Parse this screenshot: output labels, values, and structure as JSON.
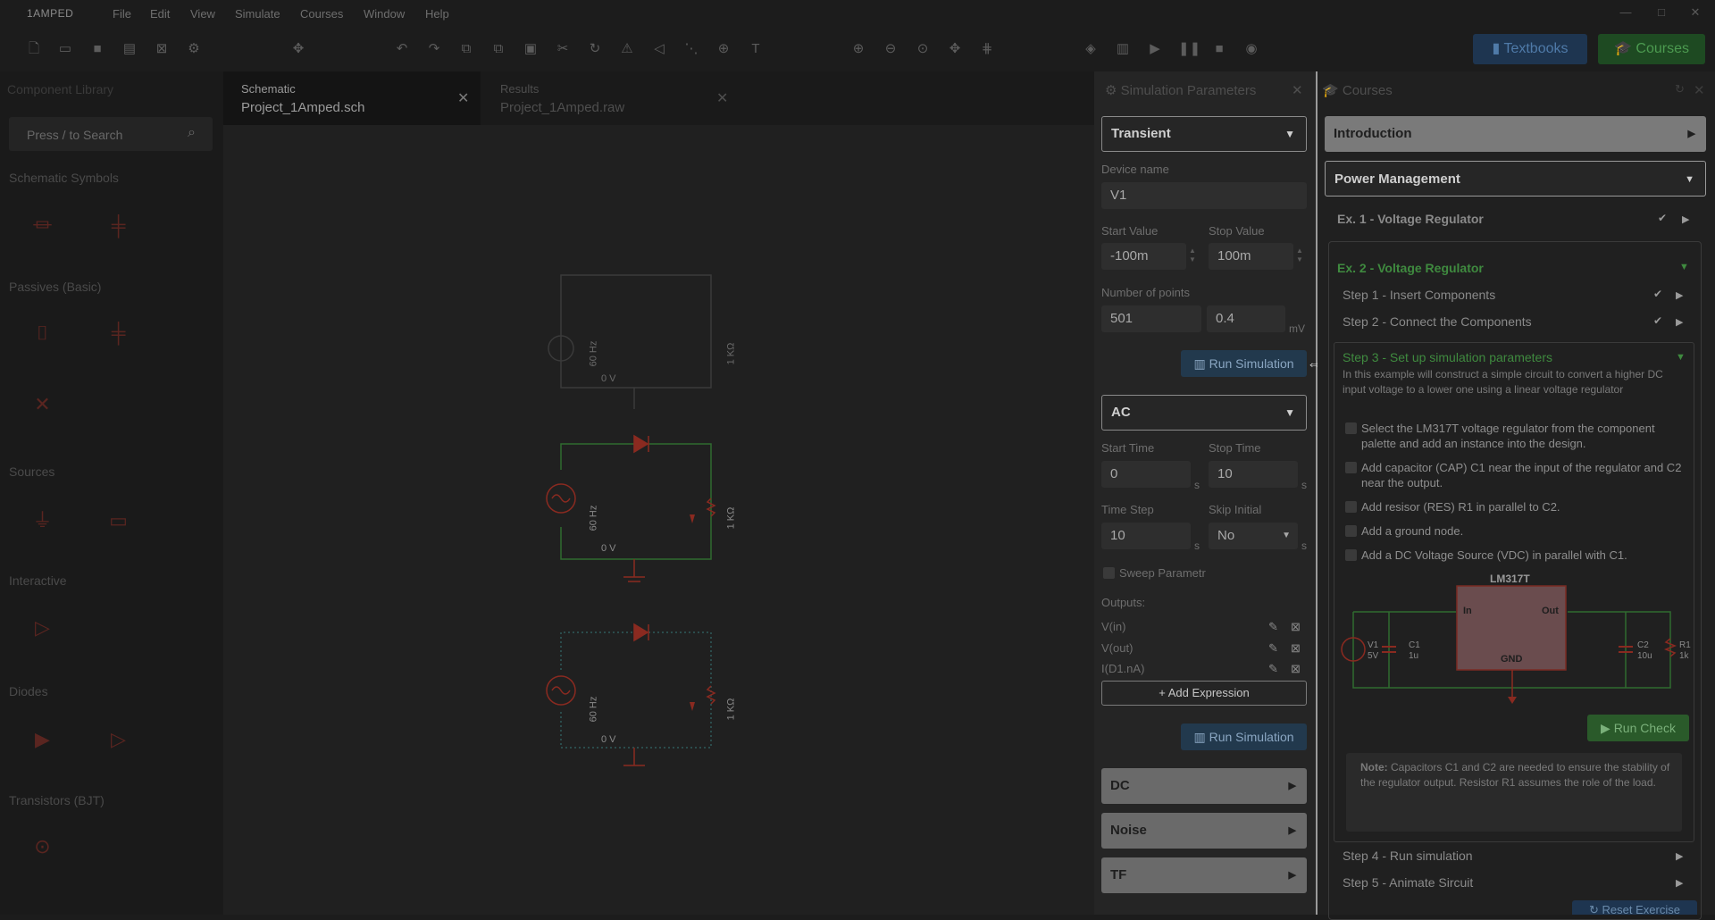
{
  "app": {
    "name": "1AMPED"
  },
  "menu": [
    "File",
    "Edit",
    "View",
    "Simulate",
    "Courses",
    "Window",
    "Help"
  ],
  "window_controls": {
    "minimize": "—",
    "maximize": "□",
    "close": "✕"
  },
  "top_buttons": {
    "textbooks": "Textbooks",
    "courses": "Courses"
  },
  "left_panel": {
    "title": "Component Library",
    "search_placeholder": "Press / to Search",
    "sections": [
      "Schematic Symbols",
      "Passives (Basic)",
      "Sources",
      "Interactive",
      "Diodes",
      "Transistors (BJT)"
    ]
  },
  "tabs": [
    {
      "type": "Schematic",
      "file": "Project_1Amped.sch"
    },
    {
      "type": "Results",
      "file": "Project_1Amped.raw"
    }
  ],
  "schematic": {
    "freq_label": "60 Hz",
    "res_label": "1 KΩ",
    "node_label": "0 V"
  },
  "sim_panel": {
    "title": "Simulation Parameters",
    "transient": {
      "mode": "Transient",
      "device_name_label": "Device name",
      "device_name": "V1",
      "start_value_label": "Start Value",
      "start_value": "-100m",
      "stop_value_label": "Stop Value",
      "stop_value": "100m",
      "points_label": "Number of points",
      "points": "501",
      "step": "0.4",
      "step_unit": "mV",
      "run_label": "Run Simulation"
    },
    "ac": {
      "mode": "AC",
      "start_time_label": "Start Time",
      "start_time": "0",
      "stop_time_label": "Stop Time",
      "stop_time": "10",
      "time_step_label": "Time Step",
      "time_step": "10",
      "skip_initial_label": "Skip Initial",
      "skip_initial": "No",
      "unit_s": "s",
      "sweep_label": "Sweep Parametr",
      "outputs_label": "Outputs:",
      "outputs": [
        "V(in)",
        "V(out)",
        "I(D1.nA)"
      ],
      "add_expression": "+ Add Expression",
      "run_label": "Run Simulation"
    },
    "collapsed": [
      "DC",
      "Noise",
      "TF"
    ]
  },
  "courses_panel": {
    "title": "Courses",
    "introduction": "Introduction",
    "power_management": "Power Management",
    "ex1": "Ex. 1 - Voltage Regulator",
    "ex2": "Ex. 2 - Voltage Regulator",
    "steps": [
      "Step 1 - Insert Components",
      "Step 2 - Connect the Components",
      "Step 3 - Set up simulation parameters",
      "Step 4 - Run simulation",
      "Step 5 - Animate Sircuit"
    ],
    "step3_desc": "In this example will construct a simple circuit to convert a higher DC input voltage to a lower one using a linear voltage regulator",
    "tasks": [
      "Select the LM317T voltage regulator from the component palette and add an instance into the design.",
      "Add capacitor (CAP) C1 near the input of the regulator and C2 near the output.",
      "Add resisor (RES) R1 in parallel to C2.",
      "Add a ground node.",
      "Add a DC Voltage Source (VDC) in parallel with C1."
    ],
    "circuit": {
      "chip": "LM317T",
      "pin_in": "In",
      "pin_out": "Out",
      "pin_gnd": "GND",
      "v1": "V1",
      "v1_val": "5V",
      "c1": "C1",
      "c1_val": "1u",
      "c2": "C2",
      "c2_val": "10u",
      "r1": "R1",
      "r1_val": "1k"
    },
    "run_check": "Run Check",
    "note_bold": "Note:",
    "note_text": " Capacitors C1 and C2 are needed to ensure the stability of the regulator output. Resistor R1 assumes the role of the load.",
    "reset": "Reset Exercise"
  },
  "colors": {
    "accent_green": "#3a9a3a",
    "accent_blue": "#4a7ab0",
    "wire_green": "#2f6b2f",
    "component_red": "#8a2a20"
  }
}
